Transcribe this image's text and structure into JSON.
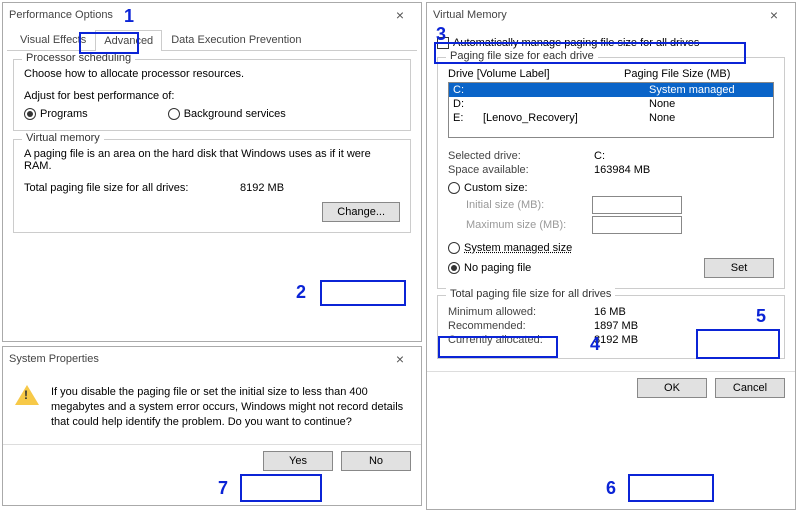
{
  "perf": {
    "title": "Performance Options",
    "tabs": {
      "visual": "Visual Effects",
      "advanced": "Advanced",
      "dep": "Data Execution Prevention"
    },
    "proc_group": "Processor scheduling",
    "proc_desc": "Choose how to allocate processor resources.",
    "proc_adjust": "Adjust for best performance of:",
    "programs": "Programs",
    "bg": "Background services",
    "vm_group": "Virtual memory",
    "vm_desc": "A paging file is an area on the hard disk that Windows uses as if it were RAM.",
    "vm_total_label": "Total paging file size for all drives:",
    "vm_total_val": "8192 MB",
    "change": "Change..."
  },
  "vm": {
    "title": "Virtual Memory",
    "auto": "Automatically manage paging file size for all drives",
    "each_group": "Paging file size for each drive",
    "header_drive": "Drive  [Volume Label]",
    "header_size": "Paging File Size (MB)",
    "drives": [
      {
        "letter": "C:",
        "label": "",
        "size": "System managed"
      },
      {
        "letter": "D:",
        "label": "",
        "size": "None"
      },
      {
        "letter": "E:",
        "label": "[Lenovo_Recovery]",
        "size": "None"
      }
    ],
    "sel_drive_label": "Selected drive:",
    "sel_drive_val": "C:",
    "space_label": "Space available:",
    "space_val": "163984 MB",
    "custom": "Custom size:",
    "init": "Initial size (MB):",
    "max": "Maximum size (MB):",
    "sysman": "System managed size",
    "nopage": "No paging file",
    "set": "Set",
    "totals_group": "Total paging file size for all drives",
    "min_label": "Minimum allowed:",
    "min_val": "16 MB",
    "rec_label": "Recommended:",
    "rec_val": "1897 MB",
    "cur_label": "Currently allocated:",
    "cur_val": "8192 MB",
    "ok": "OK",
    "cancel": "Cancel"
  },
  "sys": {
    "title": "System Properties",
    "msg": "If you disable the paging file or set the initial size to less than 400 megabytes and a system error occurs, Windows might not record details that could help identify the problem. Do you want to continue?",
    "yes": "Yes",
    "no": "No"
  },
  "anno": {
    "a1": "1",
    "a2": "2",
    "a3": "3",
    "a4": "4",
    "a5": "5",
    "a6": "6",
    "a7": "7"
  }
}
